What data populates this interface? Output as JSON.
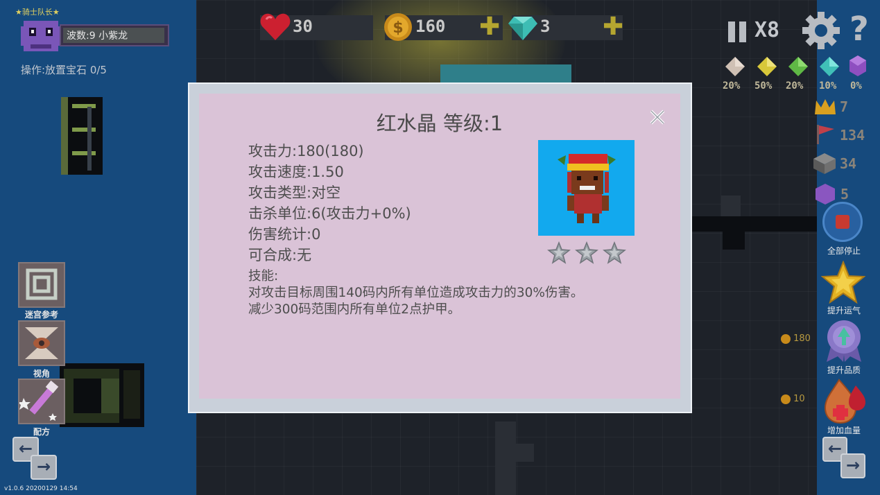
{
  "hud": {
    "health": "30",
    "gold": "160",
    "gems": "3",
    "speed_label": "X8"
  },
  "player": {
    "title": "★骑士队长★",
    "wave_text": "波数:9 小紫龙",
    "operation_text": "操作:放置宝石 0/5"
  },
  "gem_odds": [
    "20%",
    "50%",
    "20%",
    "10%",
    "0%"
  ],
  "stats_right": {
    "crown": "7",
    "flag": "134",
    "stone": "34",
    "purple": "5"
  },
  "right_buttons": {
    "stop_all": "全部停止",
    "luck": "提升运气",
    "quality": "提升品质",
    "health": "增加血量"
  },
  "costs": {
    "quality": "180",
    "health": "10"
  },
  "left_buttons": {
    "maze": "迷宫参考",
    "view": "视角",
    "recipe": "配方"
  },
  "version": "v1.0.6 20200129 14:54",
  "dialog": {
    "title": "红水晶 等级:1",
    "stats": [
      "攻击力:180(180)",
      "攻击速度:1.50",
      "攻击类型:对空",
      "击杀单位:6(攻击力+0%)",
      "伤害统计:0",
      "可合成:无"
    ],
    "skill_label": "技能:",
    "skill_lines": [
      "对攻击目标周围140码内所有单位造成攻击力的30%伤害。",
      "减少300码范围内所有单位2点护甲。"
    ],
    "star_count": 3
  },
  "colors": {
    "dialog_bg": "#dac3d7",
    "portrait_bg": "#12a9ee",
    "side_bg": "#164a7d",
    "board_bg": "#1e2229"
  }
}
